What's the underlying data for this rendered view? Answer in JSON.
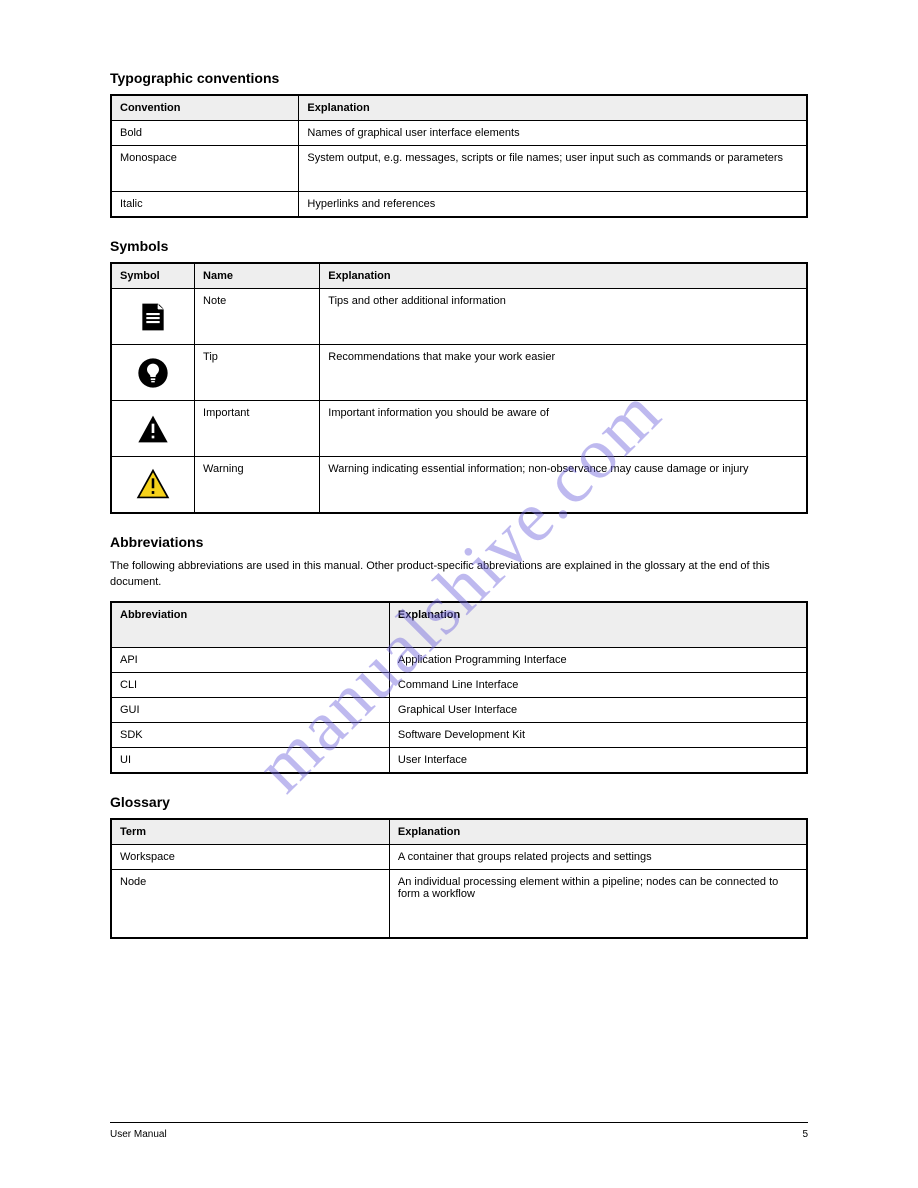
{
  "watermark": "manualshive.com",
  "typographic": {
    "heading": "Typographic conventions",
    "headers": [
      "Convention",
      "Explanation"
    ],
    "rows": [
      [
        "Bold",
        "Names of graphical user interface elements"
      ],
      [
        "Monospace",
        "System output, e.g. messages, scripts or file names; user input such as commands or parameters"
      ],
      [
        "Italic",
        "Hyperlinks and references"
      ]
    ]
  },
  "symbols": {
    "heading": "Symbols",
    "headers": [
      "Symbol",
      "Name",
      "Explanation"
    ],
    "rows": [
      [
        "note-icon",
        "Note",
        "Tips and other additional information"
      ],
      [
        "tip-icon",
        "Tip",
        "Recommendations that make your work easier"
      ],
      [
        "warn-icon",
        "Important",
        "Important information you should be aware of"
      ],
      [
        "caution-icon",
        "Warning",
        "Warning indicating essential information; non-observance may cause damage or injury"
      ]
    ]
  },
  "abbreviations": {
    "heading": "Abbreviations",
    "intro": "The following abbreviations are used in this manual. Other product-specific abbreviations are explained in the glossary at the end of this document.",
    "headers": [
      "Abbreviation",
      "Explanation"
    ],
    "rows": [
      [
        "API",
        "Application Programming Interface"
      ],
      [
        "CLI",
        "Command Line Interface"
      ],
      [
        "GUI",
        "Graphical User Interface"
      ],
      [
        "SDK",
        "Software Development Kit"
      ],
      [
        "UI",
        "User Interface"
      ]
    ]
  },
  "glossary": {
    "heading": "Glossary",
    "headers": [
      "Term",
      "Explanation"
    ],
    "rows": [
      [
        "Workspace",
        "A container that groups related projects and settings"
      ],
      [
        "Node",
        "An individual processing element within a pipeline; nodes can be connected to form a workflow"
      ]
    ]
  },
  "footer": {
    "left": "User Manual",
    "right": "5"
  }
}
